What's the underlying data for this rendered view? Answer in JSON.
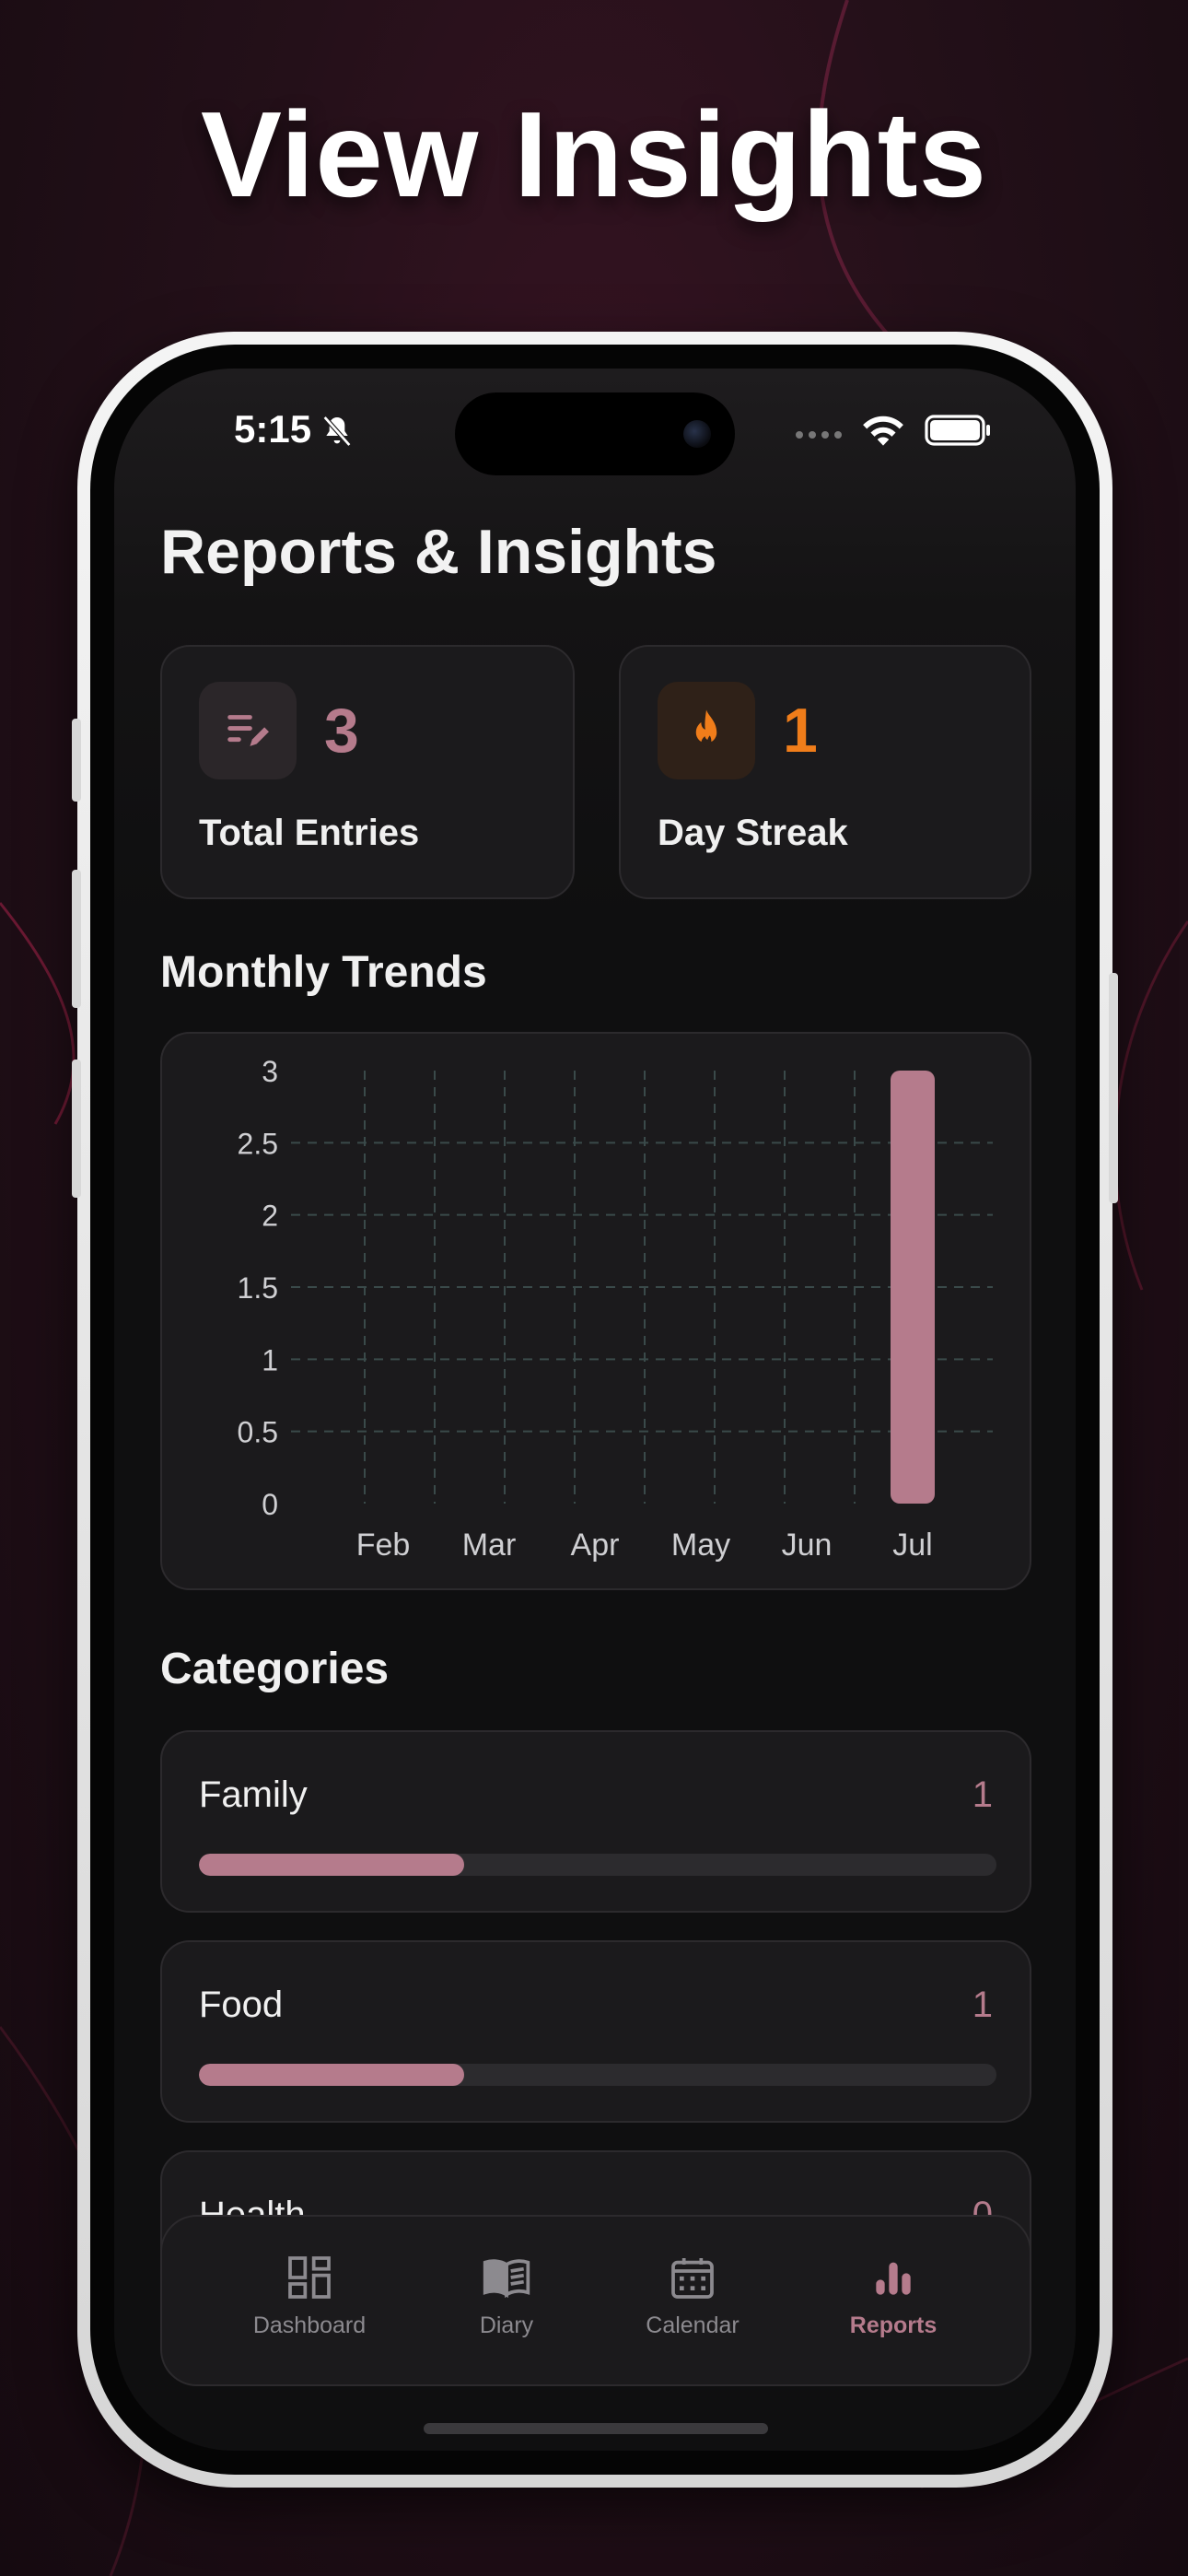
{
  "promo": {
    "title": "View Insights"
  },
  "status_bar": {
    "time": "5:15"
  },
  "page": {
    "title": "Reports & Insights"
  },
  "stats": {
    "total_entries": {
      "value": "3",
      "label": "Total Entries",
      "icon": "edit-note-icon"
    },
    "day_streak": {
      "value": "1",
      "label": "Day Streak",
      "icon": "flame-icon"
    }
  },
  "sections": {
    "monthly_trends": "Monthly Trends",
    "categories": "Categories"
  },
  "chart_data": {
    "type": "bar",
    "categories": [
      "Feb",
      "Mar",
      "Apr",
      "May",
      "Jun",
      "Jul"
    ],
    "values": [
      0,
      0,
      0,
      0,
      0,
      3
    ],
    "ylim": [
      0,
      3
    ],
    "yticks": [
      "0",
      "0.5",
      "1",
      "1.5",
      "2",
      "2.5",
      "3"
    ],
    "grid": true,
    "bar_color": "#b57b8c"
  },
  "categories": [
    {
      "name": "Family",
      "count": "1",
      "fraction": 0.333
    },
    {
      "name": "Food",
      "count": "1",
      "fraction": 0.333
    },
    {
      "name": "Health",
      "count": "0",
      "fraction": 0
    }
  ],
  "tabbar": {
    "tabs": [
      {
        "label": "Dashboard",
        "icon": "dashboard-icon",
        "active": false
      },
      {
        "label": "Diary",
        "icon": "book-icon",
        "active": false
      },
      {
        "label": "Calendar",
        "icon": "calendar-icon",
        "active": false
      },
      {
        "label": "Reports",
        "icon": "bar-chart-icon",
        "active": true
      }
    ]
  },
  "colors": {
    "accent": "#b57b8c",
    "streak": "#f07d1a",
    "background": "#0f0f10"
  }
}
